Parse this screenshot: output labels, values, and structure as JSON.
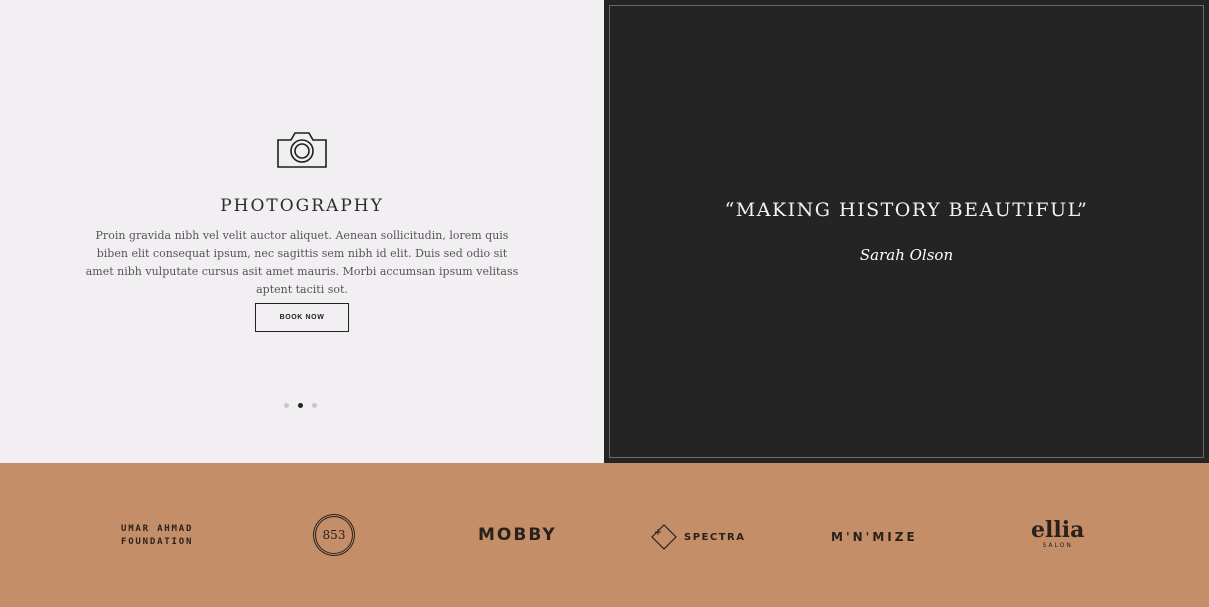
{
  "service": {
    "icon": "camera-icon",
    "title": "PHOTOGRAPHY",
    "description": "Proin gravida nibh vel velit auctor aliquet. Aenean sollicitudin, lorem quis biben elit consequat ipsum, nec sagittis sem nibh id elit. Duis sed odio sit amet nibh vulputate cursus asit amet mauris. Morbi accumsan ipsum velitass aptent taciti sot.",
    "button_label": "BOOK NOW"
  },
  "slider": {
    "count": 3,
    "active_index": 2
  },
  "testimonial": {
    "quote": "“MAKING HISTORY BEAUTIFUL”",
    "author": "Sarah Olson"
  },
  "clients": {
    "umar_line1": "UMAR AHMAD",
    "umar_line2": "FOUNDATION",
    "badge": "853",
    "mobby": "MOBBY",
    "spectra": "SPECTRA",
    "minimize": "M'N'MIZE",
    "ellia": "ellia",
    "ellia_sub": "SALON"
  },
  "colors": {
    "left_bg": "#f2eff2",
    "right_bg": "#242424",
    "logo_bar": "#c48e69"
  }
}
